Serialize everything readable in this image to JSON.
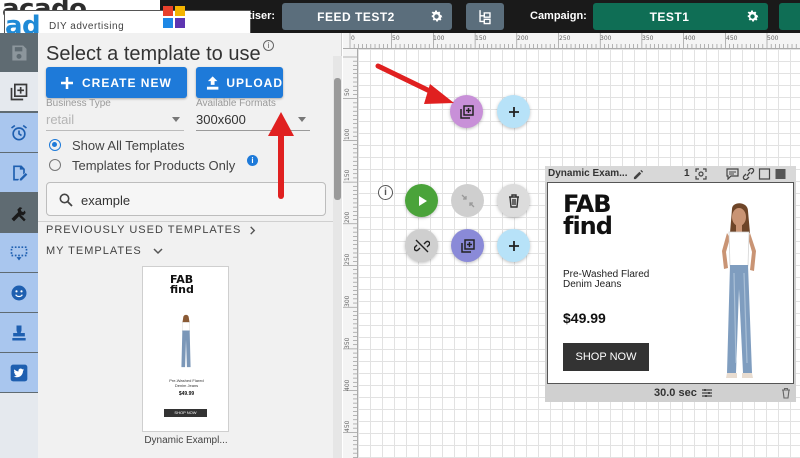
{
  "brand": {
    "name_ad": "ad",
    "name_rest": "acado",
    "tagline": "DIY advertising"
  },
  "header": {
    "advertiser_label": "Advertiser:",
    "advertiser_value": "FEED TEST2",
    "campaign_label": "Campaign:",
    "campaign_value": "TEST1"
  },
  "panel": {
    "title": "Select a template to use",
    "create_label": "CREATE NEW",
    "upload_label": "UPLOAD",
    "business_type_label": "Business Type",
    "business_type_value": "retail",
    "formats_label": "Available Formats",
    "formats_value": "300x600",
    "radio_all": "Show All Templates",
    "radio_products": "Templates for Products Only",
    "search_value": "example",
    "previously_used": "PREVIOUSLY USED TEMPLATES",
    "my_templates": "MY TEMPLATES",
    "thumb_name": "Dynamic Exampl..."
  },
  "ruler": {
    "top": [
      "0",
      "50",
      "100",
      "150",
      "200",
      "250",
      "300",
      "350",
      "400",
      "450",
      "500"
    ],
    "left": [
      "50",
      "100",
      "150",
      "200",
      "250",
      "300",
      "350",
      "400",
      "450"
    ]
  },
  "card": {
    "title": "Dynamic Exam...",
    "count": "1",
    "duration": "30.0 sec"
  },
  "ad": {
    "logo_line1": "FAB",
    "logo_line2": "find",
    "product_line1": "Pre-Washed Flared",
    "product_line2": "Denim Jeans",
    "price": "$49.99",
    "cta": "SHOP NOW"
  },
  "thumb": {
    "logo_line1": "FAB",
    "logo_line2": "find",
    "product_line1": "Pre-Washed Flared",
    "product_line2": "Denim Jeans",
    "price": "$49.99",
    "cta": "SHOP NOW"
  },
  "colors": {
    "accent_blue": "#1e7ad9",
    "campaign_green": "#0f6e55",
    "advertiser_slate": "#5b6e7c",
    "annotation_red": "#e02020"
  }
}
